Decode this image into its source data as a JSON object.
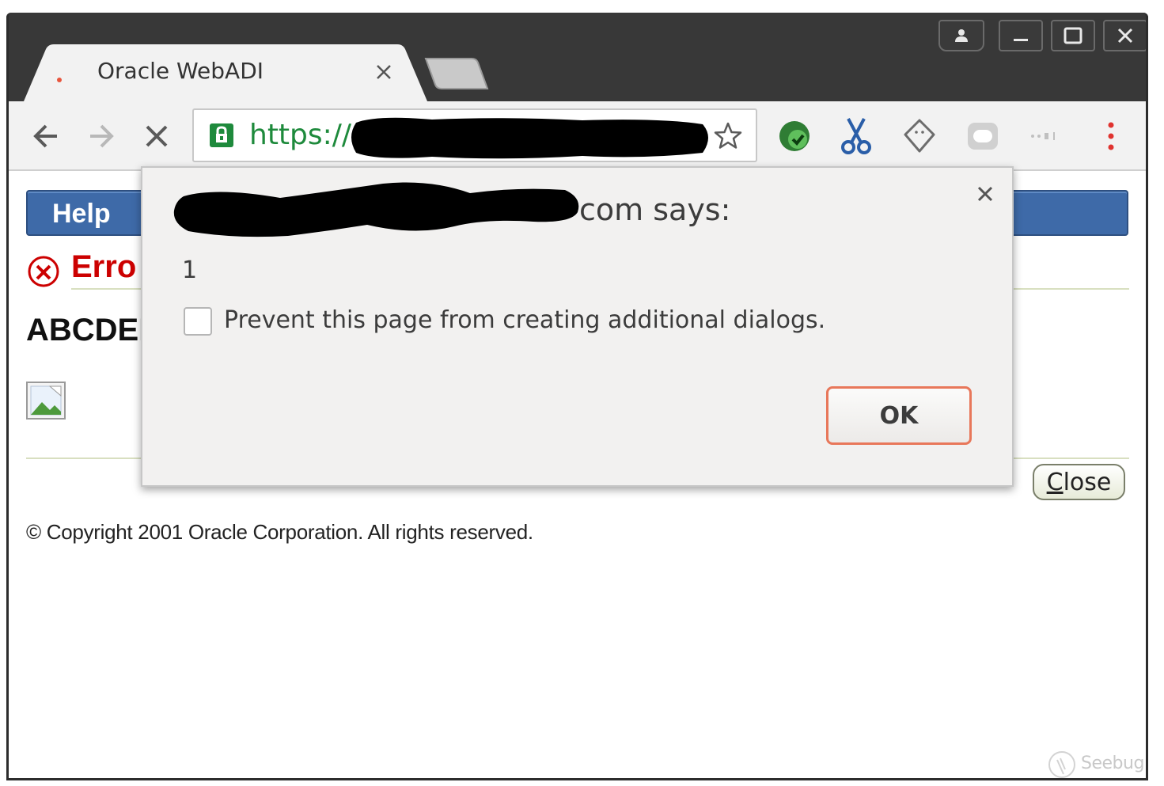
{
  "browser": {
    "tab": {
      "title": "Oracle WebADI"
    },
    "address_bar": {
      "url_visible": "https://",
      "url_redacted": true
    },
    "colors": {
      "titlebar": "#383838",
      "url_secure": "#1e8a3c",
      "menu_dots": "#e0332f"
    }
  },
  "page": {
    "help_label": "Help",
    "error_title": "Erro",
    "error_message": "ABCDEI",
    "close_button_label": "Close",
    "close_button_mnemonic": "C",
    "copyright": "© Copyright 2001 Oracle Corporation. All rights reserved.",
    "colors": {
      "help_bar": "#3e6aa8",
      "error_text": "#cc0000"
    }
  },
  "dialog": {
    "title_suffix": "com says:",
    "host_redacted": true,
    "message": "1",
    "prevent_checkbox_label": "Prevent this page from creating additional dialogs.",
    "prevent_checked": false,
    "ok_label": "OK",
    "colors": {
      "ok_border": "#e8775a"
    }
  },
  "watermark": {
    "text": "Seebug"
  },
  "icons": {
    "window": [
      "user-icon",
      "minimize-icon",
      "maximize-icon",
      "window-close-icon"
    ],
    "navigation": [
      "back-icon",
      "forward-icon",
      "stop-icon"
    ],
    "address": [
      "lock-icon",
      "star-icon"
    ],
    "extensions": [
      "extension-check-icon",
      "extension-scissors-icon",
      "extension-ghost-icon",
      "extension-pill-icon",
      "extension-dots-icon",
      "menu-icon"
    ],
    "page": [
      "error-icon",
      "broken-image-icon"
    ],
    "dialog": [
      "dialog-close-icon"
    ]
  }
}
